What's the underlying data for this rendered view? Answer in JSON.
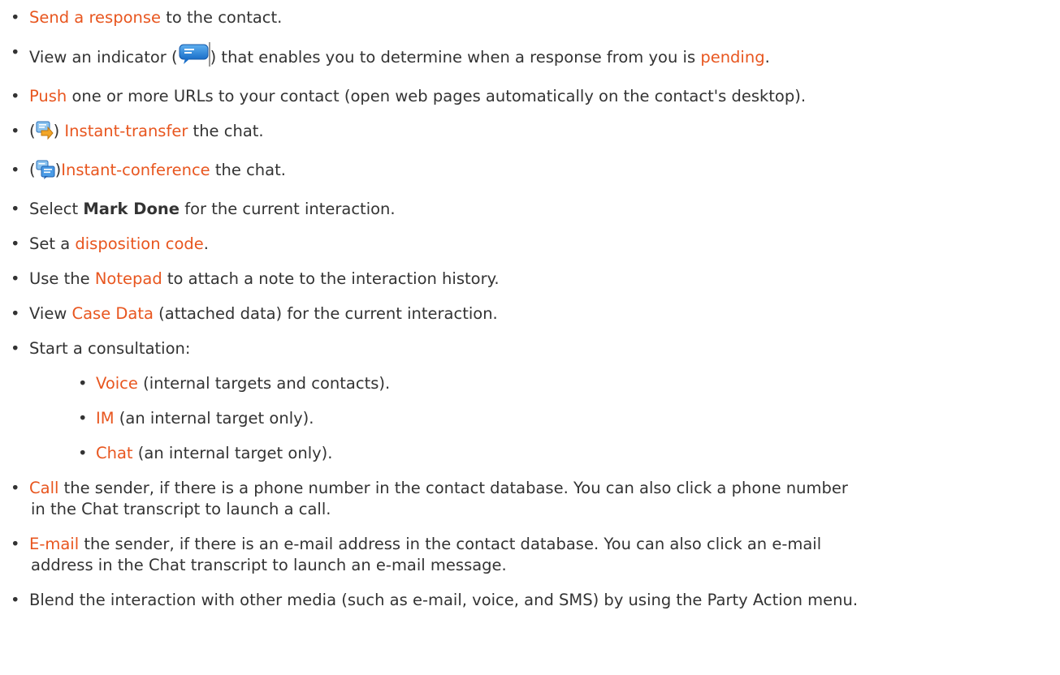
{
  "colors": {
    "link": "#e8561f",
    "text": "#333333"
  },
  "items": {
    "send": {
      "link": "Send a response",
      "rest": " to the contact."
    },
    "indicator": {
      "pre": "View an indicator (",
      "post": ") that enables you to determine when a response from you is ",
      "link": "pending",
      "end": "."
    },
    "push": {
      "link": "Push",
      "rest": " one or more URLs to your contact (open web pages automatically on the contact's desktop)."
    },
    "transfer": {
      "open": "(",
      "close": ") ",
      "link": "Instant-transfer",
      "rest": " the chat."
    },
    "conference": {
      "open": "(",
      "close": ")",
      "link": "Instant-conference",
      "rest": " the chat."
    },
    "markdone": {
      "pre": "Select ",
      "bold": "Mark Done",
      "rest": " for the current interaction."
    },
    "disposition": {
      "pre": "Set a ",
      "link": "disposition code",
      "rest": "."
    },
    "notepad": {
      "pre": "Use the ",
      "link": "Notepad",
      "rest": " to attach a note to the interaction history."
    },
    "casedata": {
      "pre": "View ",
      "link": "Case Data",
      "rest": " (attached data) for the current interaction."
    },
    "consult": {
      "text": "Start a consultation:",
      "sub": [
        {
          "link": "Voice",
          "rest": " (internal targets and contacts)."
        },
        {
          "link": "IM",
          "rest": " (an internal target only)."
        },
        {
          "link": "Chat",
          "rest": " (an internal target only)."
        }
      ]
    },
    "call": {
      "link": "Call",
      "rest1": " the sender, if there is a phone number in the contact database. You can also click a phone number",
      "rest2": "in the Chat transcript to launch a call."
    },
    "email": {
      "link": "E-mail",
      "rest1": " the sender, if there is an e-mail address in the contact database. You can also click an e-mail",
      "rest2": "address in the Chat transcript to launch an e-mail message."
    },
    "blend": {
      "text": "Blend the interaction with other media (such as e-mail, voice, and SMS) by using the Party Action menu."
    }
  },
  "icons": {
    "pending": "chat-pending-indicator-icon",
    "transfer": "instant-transfer-icon",
    "conference": "instant-conference-icon"
  }
}
